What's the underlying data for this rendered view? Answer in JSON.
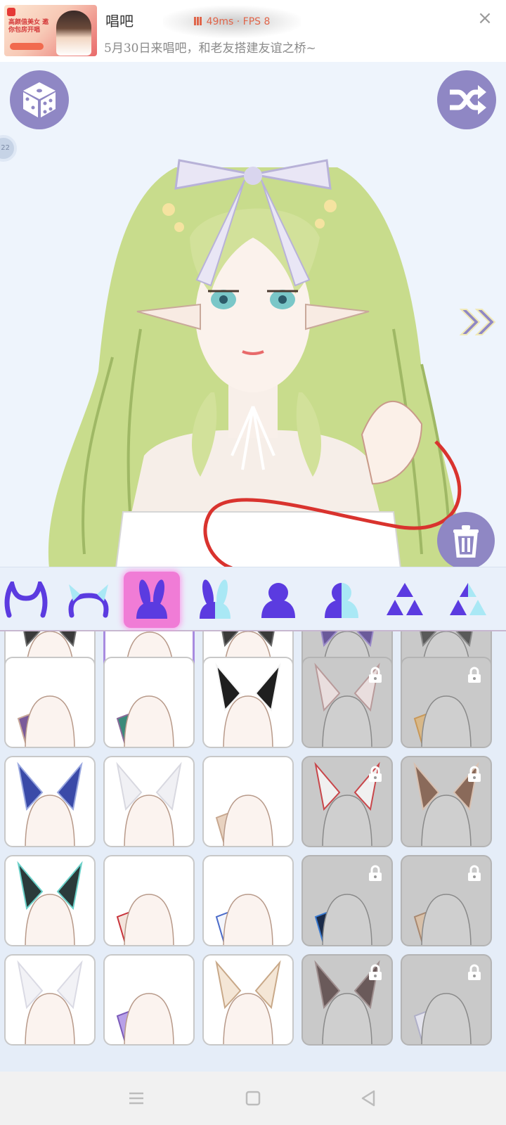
{
  "ad": {
    "title": "唱吧",
    "subtitle": "5月30日来唱吧，和老友搭建友谊之桥~",
    "thumb_text": "高颜值美女 邀你包房开唱",
    "close_glyph": "×"
  },
  "perf": {
    "latency": "49ms",
    "separator": "·",
    "fps": "FPS 8"
  },
  "stage": {
    "dice_icon": "dice-icon",
    "shuffle_icon": "shuffle-icon",
    "side_badge": "22",
    "next_icon": "double-chevron-right-icon",
    "trash_icon": "trash-icon"
  },
  "tabs": [
    {
      "id": "horns-a",
      "icon": "horns-icon",
      "selected": false
    },
    {
      "id": "horns-b",
      "icon": "horns-outline-icon",
      "selected": false
    },
    {
      "id": "ears-a",
      "icon": "bunny-ears-icon",
      "selected": true
    },
    {
      "id": "ears-b",
      "icon": "bunny-ears-back-icon",
      "selected": false
    },
    {
      "id": "body-a",
      "icon": "body-front-icon",
      "selected": false
    },
    {
      "id": "body-b",
      "icon": "body-back-icon",
      "selected": false
    },
    {
      "id": "acc-a",
      "icon": "triangles-icon",
      "selected": false
    },
    {
      "id": "acc-b",
      "icon": "triangles-back-icon",
      "selected": false
    }
  ],
  "items": [
    {
      "row": 0,
      "col": 0,
      "kind": "dark-fur",
      "locked": false,
      "selected": false
    },
    {
      "row": 0,
      "col": 1,
      "kind": "none",
      "locked": false,
      "selected": true
    },
    {
      "row": 0,
      "col": 2,
      "kind": "dark-fur",
      "locked": false,
      "selected": false
    },
    {
      "row": 0,
      "col": 3,
      "kind": "purple-fur",
      "locked": true,
      "selected": false
    },
    {
      "row": 0,
      "col": 4,
      "kind": "grey-fur",
      "locked": true,
      "selected": false
    },
    {
      "row": 1,
      "col": 0,
      "kind": "fin-ear-purple",
      "locked": false,
      "selected": false
    },
    {
      "row": 1,
      "col": 1,
      "kind": "fin-ear-teal",
      "locked": false,
      "selected": false
    },
    {
      "row": 1,
      "col": 2,
      "kind": "black-white-ears",
      "locked": false,
      "selected": false
    },
    {
      "row": 1,
      "col": 3,
      "kind": "pink-bunny-ears",
      "locked": true,
      "selected": false
    },
    {
      "row": 1,
      "col": 4,
      "kind": "tan-fur-ear",
      "locked": true,
      "selected": false
    },
    {
      "row": 2,
      "col": 0,
      "kind": "blue-feather-ears",
      "locked": false,
      "selected": false
    },
    {
      "row": 2,
      "col": 1,
      "kind": "white-round-ears",
      "locked": false,
      "selected": false
    },
    {
      "row": 2,
      "col": 2,
      "kind": "tan-elf-ear",
      "locked": false,
      "selected": false
    },
    {
      "row": 2,
      "col": 3,
      "kind": "red-fox-ears",
      "locked": true,
      "selected": false
    },
    {
      "row": 2,
      "col": 4,
      "kind": "brown-long-ears",
      "locked": true,
      "selected": false
    },
    {
      "row": 3,
      "col": 0,
      "kind": "teal-black-ears",
      "locked": false,
      "selected": false
    },
    {
      "row": 3,
      "col": 1,
      "kind": "red-long-ear",
      "locked": false,
      "selected": false
    },
    {
      "row": 3,
      "col": 2,
      "kind": "blue-white-ear",
      "locked": false,
      "selected": false
    },
    {
      "row": 3,
      "col": 3,
      "kind": "galaxy-ear",
      "locked": true,
      "selected": false
    },
    {
      "row": 3,
      "col": 4,
      "kind": "small-tan-ear",
      "locked": true,
      "selected": false
    },
    {
      "row": 4,
      "col": 0,
      "kind": "white-fluffy-ears",
      "locked": false,
      "selected": false
    },
    {
      "row": 4,
      "col": 1,
      "kind": "purple-wing-ear",
      "locked": false,
      "selected": false
    },
    {
      "row": 4,
      "col": 2,
      "kind": "cream-cat-ears",
      "locked": false,
      "selected": false
    },
    {
      "row": 4,
      "col": 3,
      "kind": "brown-wolf-ears",
      "locked": true,
      "selected": false
    },
    {
      "row": 4,
      "col": 4,
      "kind": "white-tail-ear",
      "locked": true,
      "selected": false
    }
  ],
  "navbar": {
    "menu_icon": "menu-icon",
    "home_icon": "home-icon",
    "back_icon": "back-icon"
  },
  "colors": {
    "accent": "#8f87c4",
    "tab_selected": "#f07cd6",
    "tab_icon": "#5b3be0",
    "tab_icon_light": "#a9e8f5",
    "hair": "#c8dc8c",
    "locked": "#c9c9c9"
  }
}
